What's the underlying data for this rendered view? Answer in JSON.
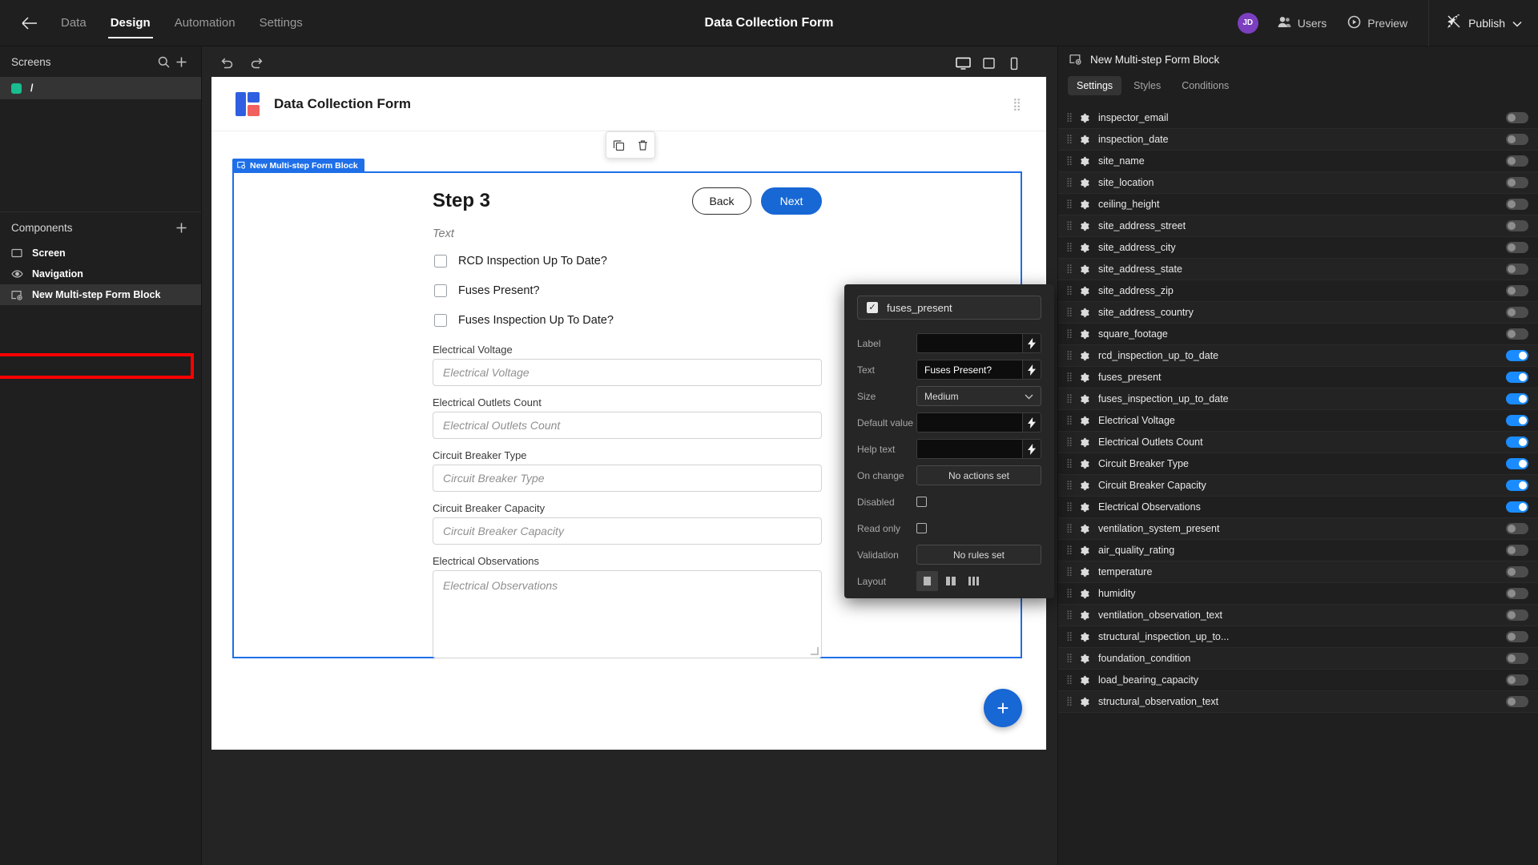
{
  "topbar": {
    "back_icon": "arrow-left-icon",
    "tabs": [
      {
        "label": "Data",
        "active": false
      },
      {
        "label": "Design",
        "active": true
      },
      {
        "label": "Automation",
        "active": false
      },
      {
        "label": "Settings",
        "active": false
      }
    ],
    "app_title": "Data Collection Form",
    "avatar_initials": "JD",
    "users_label": "Users",
    "preview_label": "Preview",
    "publish_label": "Publish"
  },
  "left_panel": {
    "screens_title": "Screens",
    "search_icon": "search-icon",
    "add_icon": "plus-icon",
    "screens": [
      {
        "path": "/",
        "selected": true
      }
    ],
    "components_title": "Components",
    "components_add_icon": "plus-icon",
    "components": [
      {
        "label": "Screen",
        "icon": "screen-icon",
        "selected": false
      },
      {
        "label": "Navigation",
        "icon": "eye-icon",
        "selected": false
      },
      {
        "label": "New Multi-step Form Block",
        "icon": "form-block-icon",
        "selected": true
      }
    ]
  },
  "canvas": {
    "undo_icon": "undo-icon",
    "redo_icon": "redo-icon",
    "devices": [
      {
        "icon": "desktop-icon",
        "active": true
      },
      {
        "icon": "tablet-icon",
        "active": false
      },
      {
        "icon": "mobile-icon",
        "active": false
      }
    ],
    "page_title": "Data Collection Form",
    "grip_icon": "drag-grid-icon",
    "float_actions": [
      {
        "icon": "duplicate-icon"
      },
      {
        "icon": "trash-icon"
      }
    ],
    "frame_tag": "New Multi-step Form Block",
    "frame_tag_icon": "form-block-icon",
    "form": {
      "step_title": "Step 3",
      "back_label": "Back",
      "next_label": "Next",
      "text_placeholder": "Text",
      "checkboxes": [
        {
          "label": "RCD Inspection Up To Date?",
          "checked": false
        },
        {
          "label": "Fuses Present?",
          "checked": false
        },
        {
          "label": "Fuses Inspection Up To Date?",
          "checked": false
        }
      ],
      "fields": [
        {
          "label": "Electrical Voltage",
          "placeholder": "Electrical Voltage",
          "type": "input"
        },
        {
          "label": "Electrical Outlets Count",
          "placeholder": "Electrical Outlets Count",
          "type": "input"
        },
        {
          "label": "Circuit Breaker Type",
          "placeholder": "Circuit Breaker Type",
          "type": "input"
        },
        {
          "label": "Circuit Breaker Capacity",
          "placeholder": "Circuit Breaker Capacity",
          "type": "input"
        },
        {
          "label": "Electrical Observations",
          "placeholder": "Electrical Observations",
          "type": "textarea"
        }
      ]
    },
    "fab_label": "+"
  },
  "popover": {
    "component_name": "fuses_present",
    "component_checked": true,
    "rows": {
      "label": {
        "label": "Label",
        "value": ""
      },
      "text": {
        "label": "Text",
        "value": "Fuses Present?",
        "highlighted": true
      },
      "size": {
        "label": "Size",
        "value": "Medium"
      },
      "default_value": {
        "label": "Default value",
        "value": ""
      },
      "help_text": {
        "label": "Help text",
        "value": ""
      },
      "on_change": {
        "label": "On change",
        "value": "No actions set"
      },
      "disabled": {
        "label": "Disabled",
        "checked": false
      },
      "read_only": {
        "label": "Read only",
        "checked": false
      },
      "validation": {
        "label": "Validation",
        "value": "No rules set"
      },
      "layout": {
        "label": "Layout",
        "selected_index": 0,
        "options": [
          "one-column",
          "two-column",
          "three-column"
        ]
      }
    },
    "bolt_icon": "lightning-bolt-icon",
    "chevron_icon": "chevron-down-icon",
    "highlight_color": "#ff0000"
  },
  "right_panel": {
    "header_title": "New Multi-step Form Block",
    "header_icon": "form-block-icon",
    "tabs": [
      {
        "label": "Settings",
        "active": true
      },
      {
        "label": "Styles",
        "active": false
      },
      {
        "label": "Conditions",
        "active": false
      }
    ],
    "fields": [
      {
        "name": "inspector_email",
        "enabled": false
      },
      {
        "name": "inspection_date",
        "enabled": false
      },
      {
        "name": "site_name",
        "enabled": false
      },
      {
        "name": "site_location",
        "enabled": false
      },
      {
        "name": "ceiling_height",
        "enabled": false
      },
      {
        "name": "site_address_street",
        "enabled": false
      },
      {
        "name": "site_address_city",
        "enabled": false
      },
      {
        "name": "site_address_state",
        "enabled": false
      },
      {
        "name": "site_address_zip",
        "enabled": false
      },
      {
        "name": "site_address_country",
        "enabled": false
      },
      {
        "name": "square_footage",
        "enabled": false
      },
      {
        "name": "rcd_inspection_up_to_date",
        "enabled": true
      },
      {
        "name": "fuses_present",
        "enabled": true
      },
      {
        "name": "fuses_inspection_up_to_date",
        "enabled": true
      },
      {
        "name": "Electrical Voltage",
        "enabled": true
      },
      {
        "name": "Electrical Outlets Count",
        "enabled": true
      },
      {
        "name": "Circuit Breaker Type",
        "enabled": true
      },
      {
        "name": "Circuit Breaker Capacity",
        "enabled": true
      },
      {
        "name": "Electrical Observations",
        "enabled": true
      },
      {
        "name": "ventilation_system_present",
        "enabled": false
      },
      {
        "name": "air_quality_rating",
        "enabled": false
      },
      {
        "name": "temperature",
        "enabled": false
      },
      {
        "name": "humidity",
        "enabled": false
      },
      {
        "name": "ventilation_observation_text",
        "enabled": false
      },
      {
        "name": "structural_inspection_up_to...",
        "enabled": false
      },
      {
        "name": "foundation_condition",
        "enabled": false
      },
      {
        "name": "load_bearing_capacity",
        "enabled": false
      },
      {
        "name": "structural_observation_text",
        "enabled": false
      }
    ],
    "gear_icon": "gear-icon",
    "drag_icon": "drag-handle-icon",
    "accent_on_color": "#1a8cff"
  }
}
